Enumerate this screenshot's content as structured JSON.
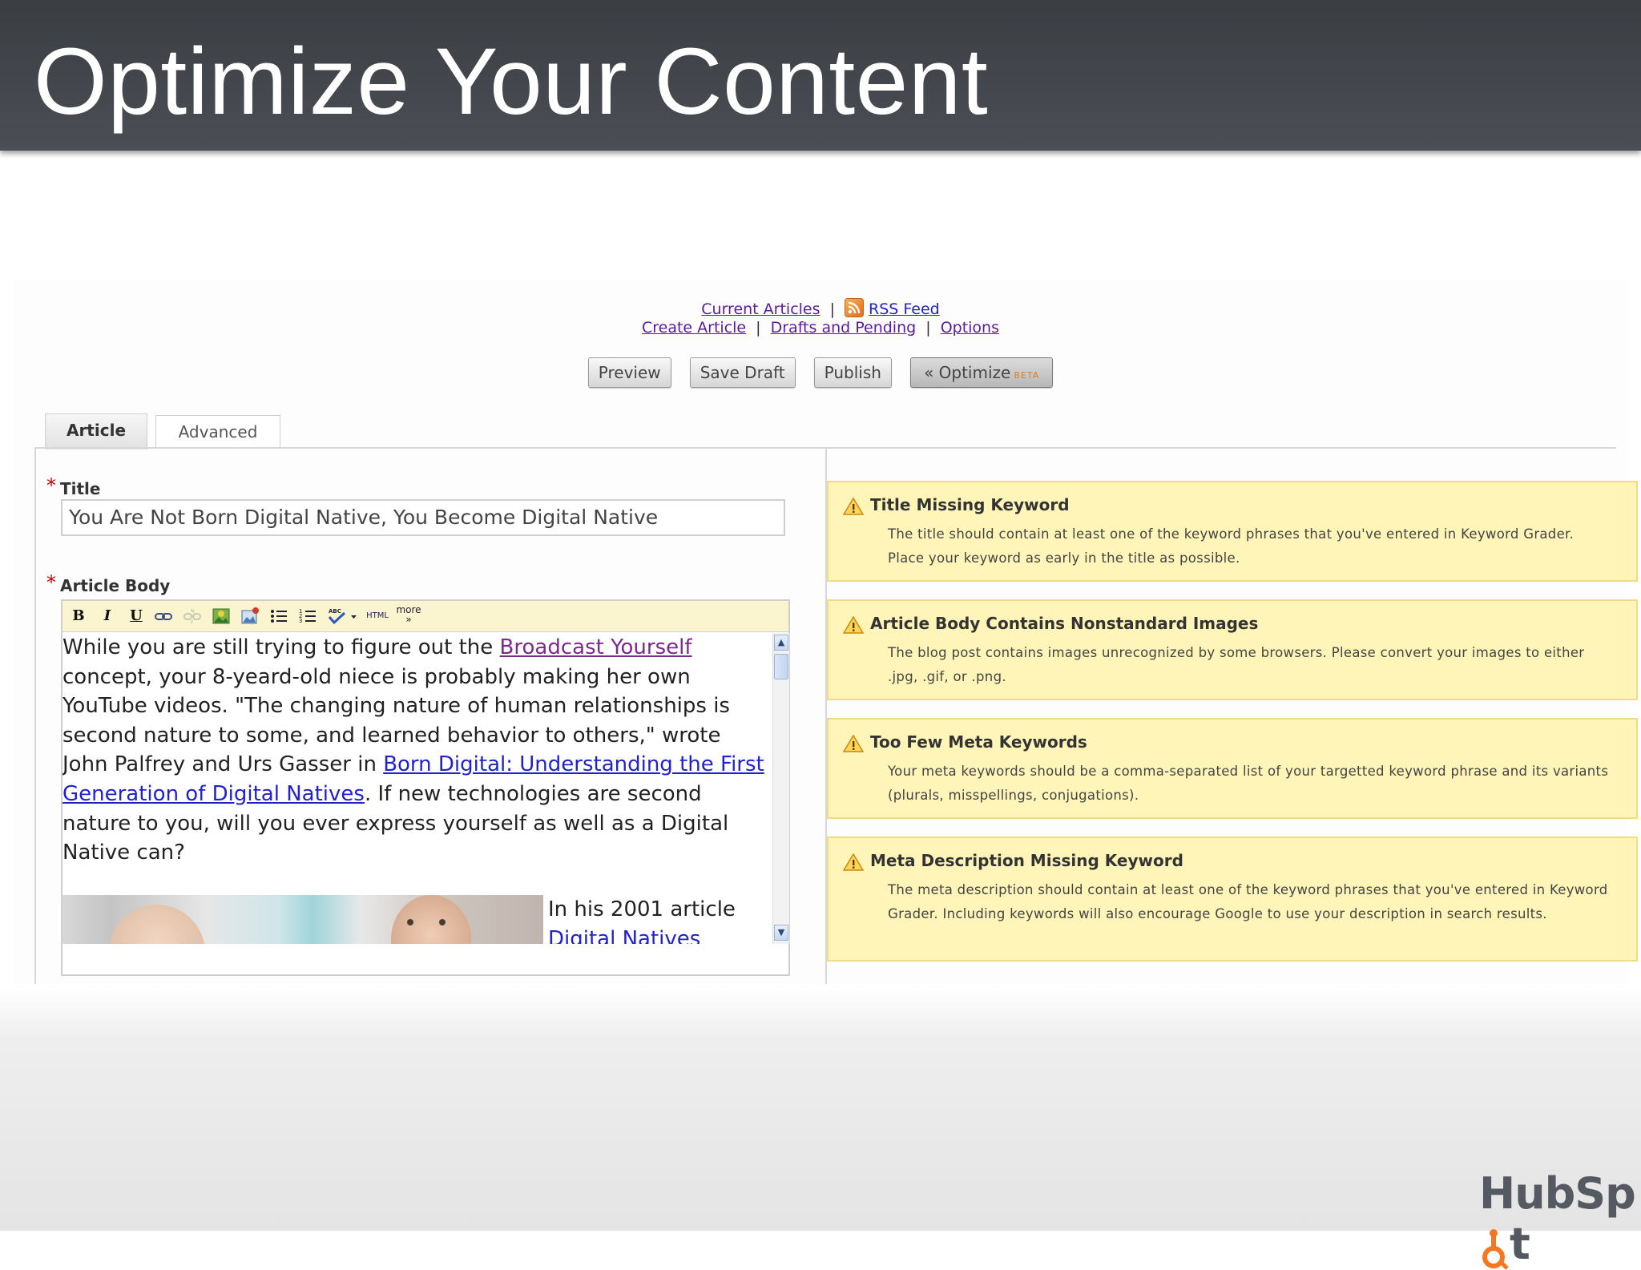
{
  "slide": {
    "title": "Optimize Your Content"
  },
  "nav": {
    "current_articles": "Current Articles",
    "separator": "|",
    "rss_feed": "RSS Feed",
    "create_article": "Create Article",
    "drafts_pending": "Drafts and Pending",
    "options": "Options"
  },
  "buttons": {
    "preview": "Preview",
    "save_draft": "Save Draft",
    "publish": "Publish",
    "optimize": "« Optimize",
    "optimize_badge": "BETA"
  },
  "tabs": {
    "article": "Article",
    "advanced": "Advanced"
  },
  "form": {
    "required_mark": "*",
    "title_label": "Title",
    "title_value": "You Are Not Born Digital Native, You Become Digital Native",
    "body_label": "Article Body"
  },
  "toolbar": {
    "bold": "B",
    "italic": "I",
    "underline": "U",
    "html": "HTML",
    "more": "more",
    "more_arrow": "»"
  },
  "body": {
    "p1_a": "While you are still trying to figure out the ",
    "p1_link1": "Broadcast Yourself",
    "p1_b": " concept, your 8-yeard-old niece is probably making her own YouTube videos. \"The changing nature of human relationships is second nature to some, and learned behavior to others,\" wrote John Palfrey and Urs Gasser in ",
    "p1_link2": "Born Digital: Understanding the First Generation of Digital Natives",
    "p1_c": ". If new technologies are second nature to you, will you ever express yourself as well as a Digital Native can?",
    "caption_a": "In his 2001 article ",
    "caption_link": "Digital Natives"
  },
  "warnings": [
    {
      "title": "Title Missing Keyword",
      "text": "The title should contain at least one of the keyword phrases that you've entered in Keyword Grader. Place your keyword as early in the title as possible."
    },
    {
      "title": "Article Body Contains Nonstandard Images",
      "text": "The blog post contains images unrecognized by some browsers. Please convert your images to either .jpg, .gif, or .png."
    },
    {
      "title": "Too Few Meta Keywords",
      "text": "Your meta keywords should be a comma-separated list of your targetted keyword phrase and its variants (plurals, misspellings, conjugations)."
    },
    {
      "title": "Meta Description Missing Keyword",
      "text": "The meta description should contain at least one of the keyword phrases that you've entered in Keyword Grader. Including keywords will also encourage Google to use your description in search results."
    }
  ],
  "branding": {
    "logo_text_a": "HubSp",
    "logo_text_b": "t"
  },
  "colors": {
    "header_bg": "#42464c",
    "warning_bg": "#fff5b8",
    "warning_border": "#f1dc86",
    "visited_link": "#7a2a8a",
    "link": "#2222cc",
    "required": "#cc0000",
    "toolbar_bg": "#faf5cf",
    "hubspot_accent": "#f57722"
  }
}
